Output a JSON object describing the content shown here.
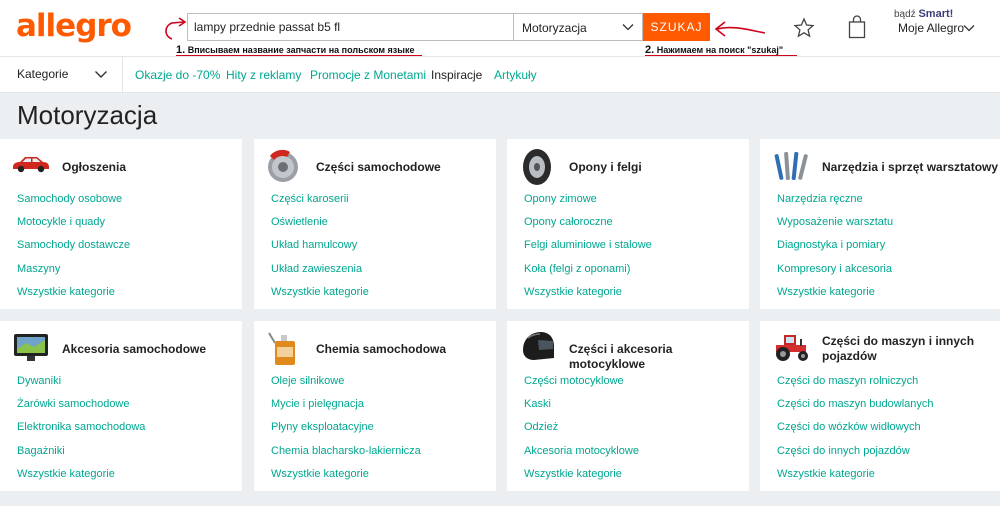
{
  "header": {
    "logo": "allegro",
    "search_value": "lampy przednie passat b5 fl",
    "category_selected": "Motoryzacja",
    "search_button": "SZUKAJ",
    "smart_prefix": "bądź",
    "smart_label": "Smart!",
    "account_label": "Moje Allegro"
  },
  "annotations": {
    "step1_num": "1.",
    "step1_text": "Вписываем название запчасти на польском языке",
    "step2_num": "2.",
    "step2_text": "Нажимаем на поиск \"szukaj\"",
    "color": "#d0021b"
  },
  "nav": {
    "kategorie": "Kategorie",
    "links": [
      "Okazje do -70%",
      "Hity z reklamy",
      "Promocje z Monetami",
      "Inspiracje",
      "Artykuły"
    ]
  },
  "page_title": "Motoryzacja",
  "cards": [
    {
      "title": "Ogłoszenia",
      "icon": "car-icon",
      "links": [
        "Samochody osobowe",
        "Motocykle i quady",
        "Samochody dostawcze",
        "Maszyny",
        "Wszystkie kategorie"
      ]
    },
    {
      "title": "Części samochodowe",
      "icon": "brake-disc-icon",
      "links": [
        "Części karoserii",
        "Oświetlenie",
        "Układ hamulcowy",
        "Układ zawieszenia",
        "Wszystkie kategorie"
      ]
    },
    {
      "title": "Opony i felgi",
      "icon": "tire-icon",
      "links": [
        "Opony zimowe",
        "Opony całoroczne",
        "Felgi aluminiowe i stalowe",
        "Koła (felgi z oponami)",
        "Wszystkie kategorie"
      ]
    },
    {
      "title": "Narzędzia i sprzęt warsztatowy",
      "icon": "tools-icon",
      "links": [
        "Narzędzia ręczne",
        "Wyposażenie warsztatu",
        "Diagnostyka i pomiary",
        "Kompresory i akcesoria",
        "Wszystkie kategorie"
      ]
    },
    {
      "title": "Akcesoria samochodowe",
      "icon": "gps-icon",
      "links": [
        "Dywaniki",
        "Żarówki samochodowe",
        "Elektronika samochodowa",
        "Bagażniki",
        "Wszystkie kategorie"
      ]
    },
    {
      "title": "Chemia samochodowa",
      "icon": "oil-can-icon",
      "links": [
        "Oleje silnikowe",
        "Mycie i pielęgnacja",
        "Płyny eksploatacyjne",
        "Chemia blacharsko-lakiernicza",
        "Wszystkie kategorie"
      ]
    },
    {
      "title": "Części i akcesoria motocyklowe",
      "icon": "helmet-icon",
      "links": [
        "Części motocyklowe",
        "Kaski",
        "Odzież",
        "Akcesoria motocyklowe",
        "Wszystkie kategorie"
      ]
    },
    {
      "title": "Części do maszyn i innych pojazdów",
      "icon": "tractor-icon",
      "links": [
        "Części do maszyn rolniczych",
        "Części do maszyn budowlanych",
        "Części do wózków widłowych",
        "Części do innych pojazdów",
        "Wszystkie kategorie"
      ]
    }
  ],
  "colors": {
    "brand": "#ff5a00",
    "link": "#00a790",
    "background": "#eceff1"
  }
}
